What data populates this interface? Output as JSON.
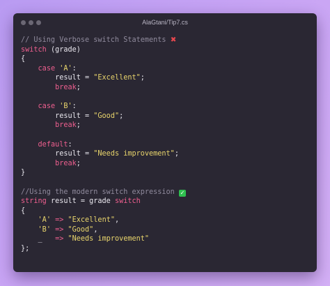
{
  "window": {
    "title": "AlaGtani/Tip7.cs"
  },
  "icons": {
    "cross": "cross-mark-icon",
    "check": "check-mark-icon"
  },
  "code": {
    "l1_comment": "// Using Verbose switch Statements",
    "l1_mark": "✖",
    "l2_kw": "switch",
    "l2_rest": " (grade)",
    "l3": "{",
    "l4_indent": "    ",
    "l4_kw": "case",
    "l4_str": " 'A'",
    "l4_rest": ":",
    "l5_pre": "        result = ",
    "l5_str": "\"Excellent\"",
    "l5_post": ";",
    "l6_indent": "        ",
    "l6_kw": "break",
    "l6_post": ";",
    "l8_indent": "    ",
    "l8_kw": "case",
    "l8_str": " 'B'",
    "l8_rest": ":",
    "l9_pre": "        result = ",
    "l9_str": "\"Good\"",
    "l9_post": ";",
    "l10_indent": "        ",
    "l10_kw": "break",
    "l10_post": ";",
    "l12_indent": "    ",
    "l12_kw": "default",
    "l12_rest": ":",
    "l13_pre": "        result = ",
    "l13_str": "\"Needs improvement\"",
    "l13_post": ";",
    "l14_indent": "        ",
    "l14_kw": "break",
    "l14_post": ";",
    "l15": "}",
    "l17_comment": "//Using the modern switch expression",
    "l17_mark": "✓",
    "l18_kw1": "string",
    "l18_mid": " result = grade ",
    "l18_kw2": "switch",
    "l19": "{",
    "l20_indent": "    ",
    "l20_str1": "'A'",
    "l20_arrow": " => ",
    "l20_str2": "\"Excellent\"",
    "l20_post": ",",
    "l21_indent": "    ",
    "l21_str1": "'B'",
    "l21_arrow": " => ",
    "l21_str2": "\"Good\"",
    "l21_post": ",",
    "l22_indent": "    ",
    "l22_pre": "_",
    "l22_arrow": "   => ",
    "l22_str2": "\"Needs improvement\"",
    "l23": "};"
  }
}
